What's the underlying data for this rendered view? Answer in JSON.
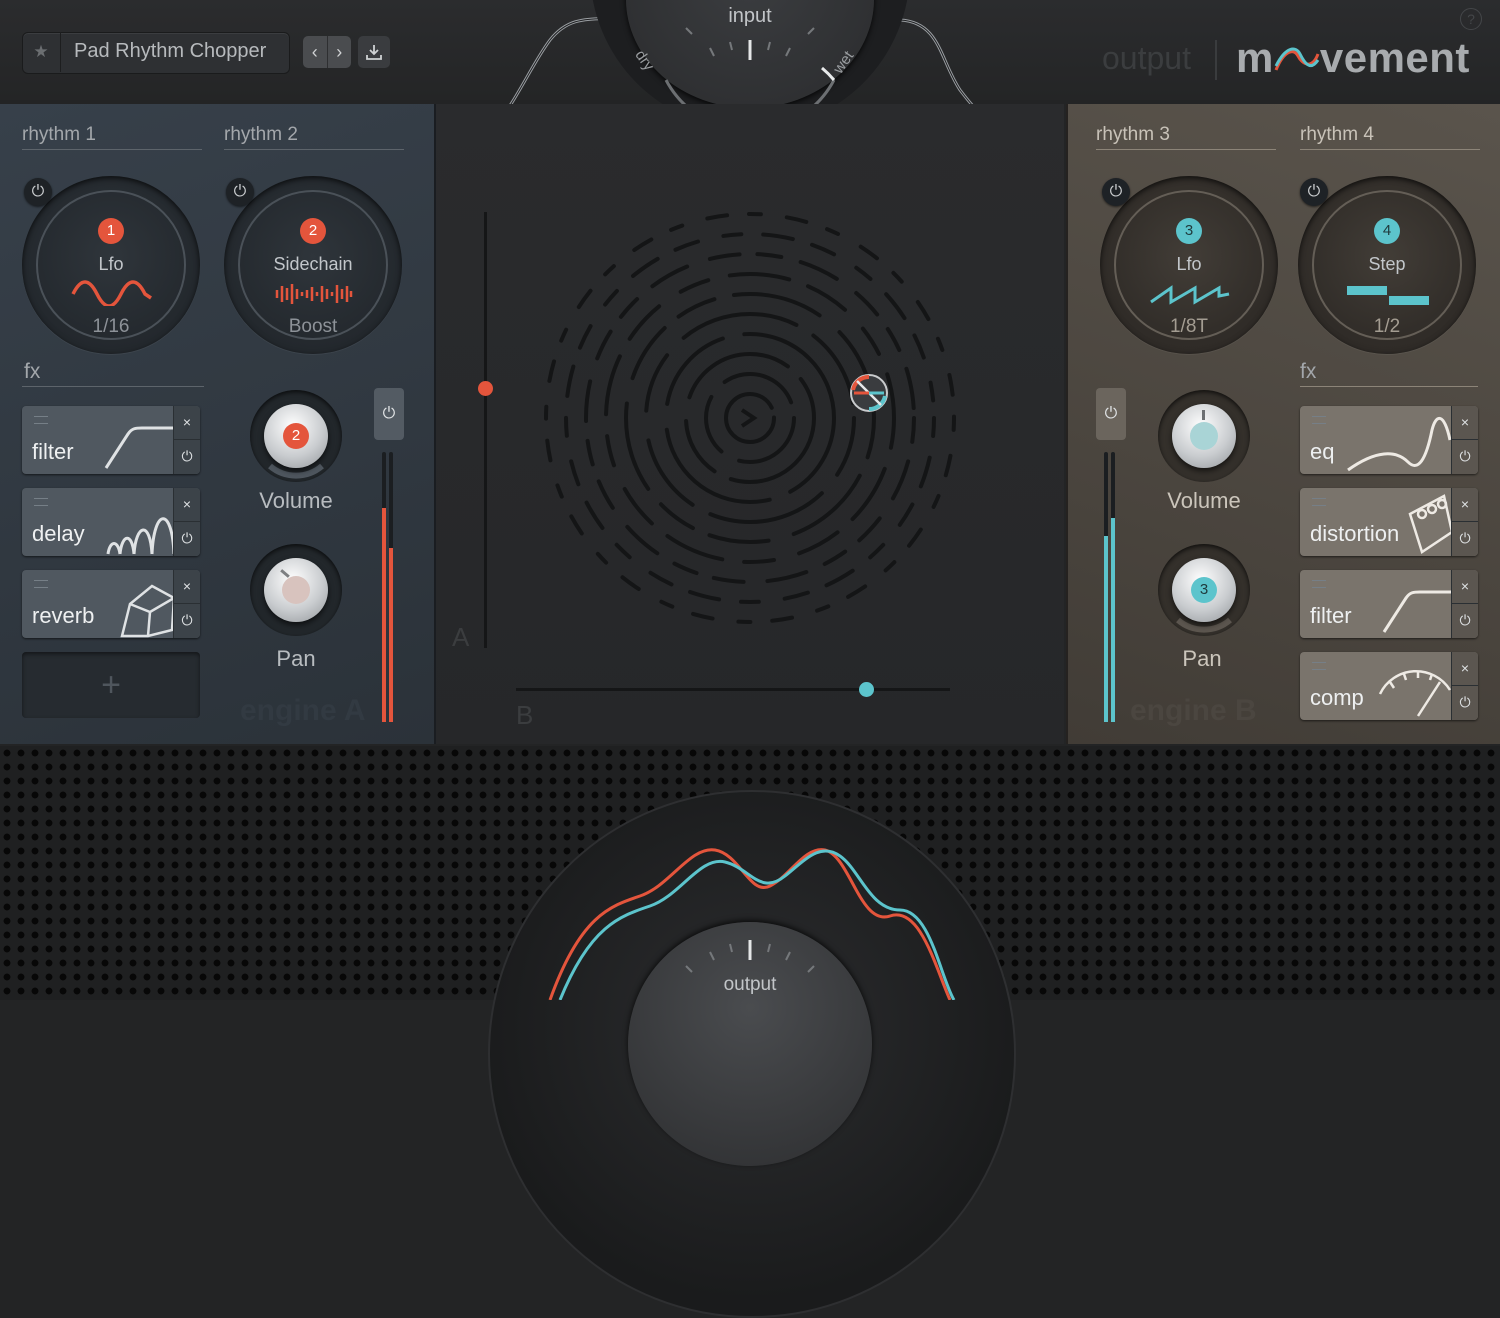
{
  "preset": {
    "name": "Pad Rhythm Chopper"
  },
  "header": {
    "output_label": "output",
    "logo_parts": [
      "m",
      "vement"
    ],
    "help": "?"
  },
  "input_dial": {
    "label": "input",
    "dry": "dry",
    "wet": "wet"
  },
  "engine_a": {
    "name": "engine A",
    "rhythms": [
      {
        "label": "rhythm 1",
        "badge": "1",
        "type": "Lfo",
        "value": "1/16"
      },
      {
        "label": "rhythm 2",
        "badge": "2",
        "type": "Sidechain",
        "value": "Boost"
      }
    ],
    "fx_label": "fx",
    "fx": [
      {
        "name": "filter"
      },
      {
        "name": "delay"
      },
      {
        "name": "reverb"
      }
    ],
    "add_fx": "+",
    "volume": {
      "label": "Volume",
      "badge": "2"
    },
    "pan": {
      "label": "Pan"
    },
    "accent": "#e4553c"
  },
  "engine_b": {
    "name": "engine B",
    "rhythms": [
      {
        "label": "rhythm 3",
        "badge": "3",
        "type": "Lfo",
        "value": "1/8T"
      },
      {
        "label": "rhythm 4",
        "badge": "4",
        "type": "Step",
        "value": "1/2"
      }
    ],
    "fx_label": "fx",
    "fx": [
      {
        "name": "eq"
      },
      {
        "name": "distortion"
      },
      {
        "name": "filter"
      },
      {
        "name": "comp"
      }
    ],
    "volume": {
      "label": "Volume"
    },
    "pan": {
      "label": "Pan",
      "badge": "3"
    },
    "accent": "#5cc4cc"
  },
  "xy_pad": {
    "axis_a": "A",
    "axis_b": "B",
    "slider_a": 0.6,
    "slider_b": 0.82
  },
  "output_dial": {
    "label": "output"
  },
  "icons": {
    "close": "×",
    "power": "⏻",
    "star": "★",
    "prev": "‹",
    "next": "›"
  }
}
